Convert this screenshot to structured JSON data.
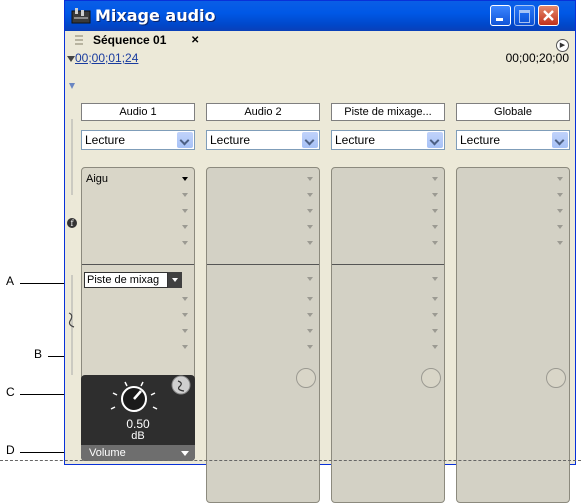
{
  "window": {
    "title": "Mixage audio"
  },
  "sequence_tab": {
    "label": "Séquence 01",
    "close_glyph": "✕"
  },
  "timeline": {
    "current_time": "00;00;01;24",
    "duration": "00;00;20;00"
  },
  "callouts": [
    {
      "letter": "A",
      "target": "send-assignment-select"
    },
    {
      "letter": "B",
      "target": "send-toggle-icon"
    },
    {
      "letter": "C",
      "target": "send-volume-knob"
    },
    {
      "letter": "D",
      "target": "send-property-menu"
    }
  ],
  "tracks": [
    {
      "name": "Audio 1",
      "mode": "Lecture",
      "effect_slot": "Aigu",
      "send_slot": "Piste de mixag",
      "volume_value": "0.50",
      "volume_unit": "dB",
      "volume_label": "Volume"
    },
    {
      "name": "Audio 2",
      "mode": "Lecture"
    },
    {
      "name": "Piste de mixage...",
      "mode": "Lecture"
    },
    {
      "name": "Globale",
      "mode": "Lecture"
    }
  ],
  "colors": {
    "titlebar": "#0058e6",
    "close_button": "#c1311a",
    "panel_background": "#d9d6c8",
    "volume_panel": "#2e2e2e",
    "timecode": "#1a3c9f"
  },
  "icons": {
    "app": "mixer-icon",
    "collapse": "chevron-down-icon",
    "effects": "fx-icon",
    "sends": "send-icon",
    "send_toggle": "send-toggle-icon",
    "volume_knob": "knob-icon"
  }
}
